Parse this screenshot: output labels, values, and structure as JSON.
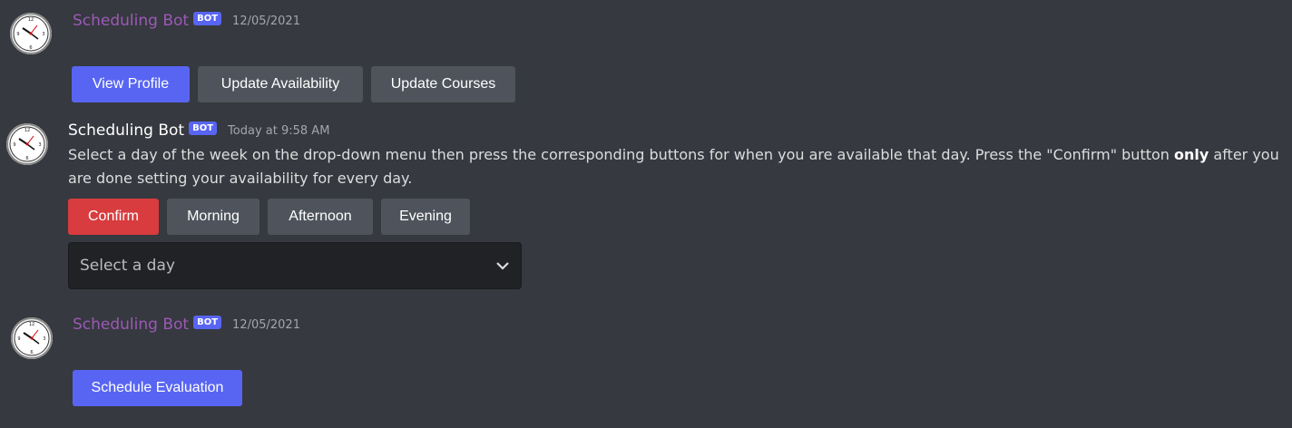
{
  "messages": [
    {
      "author": "Scheduling Bot",
      "tag": "BOT",
      "timestamp": "12/05/2021",
      "buttons": [
        "View Profile",
        "Update Availability",
        "Update Courses"
      ]
    },
    {
      "author": "Scheduling Bot",
      "tag": "BOT",
      "timestamp": "Today at 9:58 AM",
      "text_before": "Select a day of the week on the drop-down menu then press the corresponding buttons for when you are available that day. Press the \"Confirm\" button ",
      "text_bold": "only",
      "text_after": " after you are done setting your availability for every day.",
      "buttons": [
        "Confirm",
        "Morning",
        "Afternoon",
        "Evening"
      ],
      "select_placeholder": "Select a day"
    },
    {
      "author": "Scheduling Bot",
      "tag": "BOT",
      "timestamp": "12/05/2021",
      "buttons": [
        "Schedule Evaluation"
      ]
    }
  ],
  "colors": {
    "background": "#36393f",
    "blurple": "#5865f2",
    "grey_button": "#4f545c",
    "danger": "#d83c3e",
    "select_bg": "#202225",
    "author_purple": "#9b59b6"
  },
  "icons": [
    "clock-avatar-icon",
    "chevron-down-icon"
  ]
}
